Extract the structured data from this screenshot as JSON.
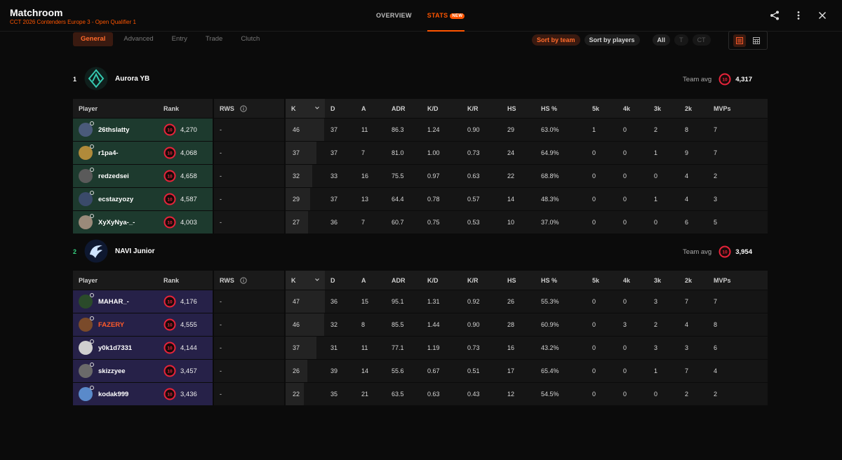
{
  "app": {
    "title": "Matchroom",
    "subtitle": "CCT 2026 Contenders Europe 3 - Open Qualifier 1"
  },
  "nav": {
    "tabs": [
      {
        "label": "OVERVIEW",
        "active": false
      },
      {
        "label": "STATS",
        "active": true,
        "badge": "NEW"
      }
    ]
  },
  "subtabs": [
    "General",
    "Advanced",
    "Entry",
    "Trade",
    "Clutch"
  ],
  "sort": {
    "by_team": "Sort by team",
    "by_players": "Sort by players",
    "sides": [
      "All",
      "T",
      "CT"
    ]
  },
  "columns": [
    "Player",
    "Rank",
    "RWS",
    "K",
    "D",
    "A",
    "ADR",
    "K/D",
    "K/R",
    "HS",
    "HS %",
    "5k",
    "4k",
    "3k",
    "2k",
    "MVPs"
  ],
  "colors": {
    "accent": "#ff5500",
    "team1_row": "#1d3a2e",
    "team2_row": "#262148"
  },
  "level_badge": "10",
  "teams": [
    {
      "rank": "1",
      "name": "Aurora YB",
      "avg_label": "Team avg",
      "avg": "4,317",
      "players": [
        {
          "name": "26thslatty",
          "elo": "4,270",
          "rws": "-",
          "k": "46",
          "d": "37",
          "a": "11",
          "adr": "86.3",
          "kd": "1.24",
          "kr": "0.90",
          "hs": "29",
          "hsp": "63.0%",
          "k5": "1",
          "k4": "0",
          "k3": "2",
          "k2": "8",
          "mvps": "7"
        },
        {
          "name": "r1pa4-",
          "elo": "4,068",
          "rws": "-",
          "k": "37",
          "d": "37",
          "a": "7",
          "adr": "81.0",
          "kd": "1.00",
          "kr": "0.73",
          "hs": "24",
          "hsp": "64.9%",
          "k5": "0",
          "k4": "0",
          "k3": "1",
          "k2": "9",
          "mvps": "7"
        },
        {
          "name": "redzedsei",
          "elo": "4,658",
          "rws": "-",
          "k": "32",
          "d": "33",
          "a": "16",
          "adr": "75.5",
          "kd": "0.97",
          "kr": "0.63",
          "hs": "22",
          "hsp": "68.8%",
          "k5": "0",
          "k4": "0",
          "k3": "0",
          "k2": "4",
          "mvps": "2"
        },
        {
          "name": "ecstazyozy",
          "elo": "4,587",
          "rws": "-",
          "k": "29",
          "d": "37",
          "a": "13",
          "adr": "64.4",
          "kd": "0.78",
          "kr": "0.57",
          "hs": "14",
          "hsp": "48.3%",
          "k5": "0",
          "k4": "0",
          "k3": "1",
          "k2": "4",
          "mvps": "3"
        },
        {
          "name": "XyXyNya-_-",
          "elo": "4,003",
          "rws": "-",
          "k": "27",
          "d": "36",
          "a": "7",
          "adr": "60.7",
          "kd": "0.75",
          "kr": "0.53",
          "hs": "10",
          "hsp": "37.0%",
          "k5": "0",
          "k4": "0",
          "k3": "0",
          "k2": "6",
          "mvps": "5"
        }
      ]
    },
    {
      "rank": "2",
      "name": "NAVI Junior",
      "avg_label": "Team avg",
      "avg": "3,954",
      "players": [
        {
          "name": "MAHAR_-",
          "elo": "4,176",
          "rws": "-",
          "k": "47",
          "d": "36",
          "a": "15",
          "adr": "95.1",
          "kd": "1.31",
          "kr": "0.92",
          "hs": "26",
          "hsp": "55.3%",
          "k5": "0",
          "k4": "0",
          "k3": "3",
          "k2": "7",
          "mvps": "7"
        },
        {
          "name": "FAZERY",
          "elo": "4,555",
          "rws": "-",
          "k": "46",
          "d": "32",
          "a": "8",
          "adr": "85.5",
          "kd": "1.44",
          "kr": "0.90",
          "hs": "28",
          "hsp": "60.9%",
          "k5": "0",
          "k4": "3",
          "k3": "2",
          "k2": "4",
          "mvps": "8",
          "highlight": true
        },
        {
          "name": "y0k1d7331",
          "elo": "4,144",
          "rws": "-",
          "k": "37",
          "d": "31",
          "a": "11",
          "adr": "77.1",
          "kd": "1.19",
          "kr": "0.73",
          "hs": "16",
          "hsp": "43.2%",
          "k5": "0",
          "k4": "0",
          "k3": "3",
          "k2": "3",
          "mvps": "6"
        },
        {
          "name": "skizzyee",
          "elo": "3,457",
          "rws": "-",
          "k": "26",
          "d": "39",
          "a": "14",
          "adr": "55.6",
          "kd": "0.67",
          "kr": "0.51",
          "hs": "17",
          "hsp": "65.4%",
          "k5": "0",
          "k4": "0",
          "k3": "1",
          "k2": "7",
          "mvps": "4"
        },
        {
          "name": "kodak999",
          "elo": "3,436",
          "rws": "-",
          "k": "22",
          "d": "35",
          "a": "21",
          "adr": "63.5",
          "kd": "0.63",
          "kr": "0.43",
          "hs": "12",
          "hsp": "54.5%",
          "k5": "0",
          "k4": "0",
          "k3": "0",
          "k2": "2",
          "mvps": "2"
        }
      ]
    }
  ]
}
